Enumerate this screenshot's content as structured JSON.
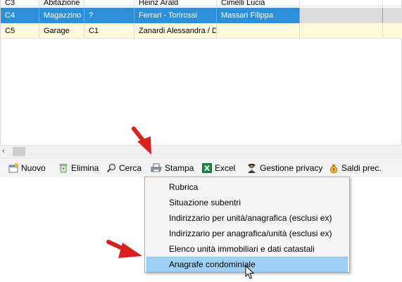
{
  "grid": {
    "rows": [
      {
        "code": "C3",
        "type": "Abitazione",
        "sub": "",
        "owner": "Heinz Arald",
        "tenant": "Cimelli Lucia",
        "extra": ""
      },
      {
        "code": "C4",
        "type": "Magazzino",
        "sub": "?",
        "owner": "Ferrari - Torirossi",
        "tenant": "Massari Filippa",
        "extra": ""
      },
      {
        "code": "C5",
        "type": "Garage",
        "sub": "C1",
        "owner": "Zanardi Alessandra / Do",
        "tenant": "",
        "extra": ""
      }
    ]
  },
  "toolbar": {
    "nuovo": "Nuovo",
    "elimina": "Elimina",
    "cerca": "Cerca",
    "stampa": "Stampa",
    "excel": "Excel",
    "privacy": "Gestione privacy",
    "saldi": "Saldi prec."
  },
  "menu": {
    "items": [
      "Rubrica",
      "Situazione subentri",
      "Indirizzario per unità/anagrafica (esclusi ex)",
      "Indirizzario per anagrafica/unità (esclusi ex)",
      "Elenco unità immobiliari e dati catastali",
      "Anagrafe condominiale"
    ],
    "highlighted_index": 5
  },
  "icons": {
    "nuovo": "new-record-icon",
    "elimina": "trash-icon",
    "cerca": "magnifier-icon",
    "stampa": "printer-icon",
    "excel": "excel-icon",
    "privacy": "privacy-agent-icon",
    "saldi": "money-bag-icon"
  },
  "colors": {
    "selected_row": "#2e8fd9",
    "menu_highlight": "#9fd0f5",
    "annotation_arrow": "#d8201c"
  }
}
